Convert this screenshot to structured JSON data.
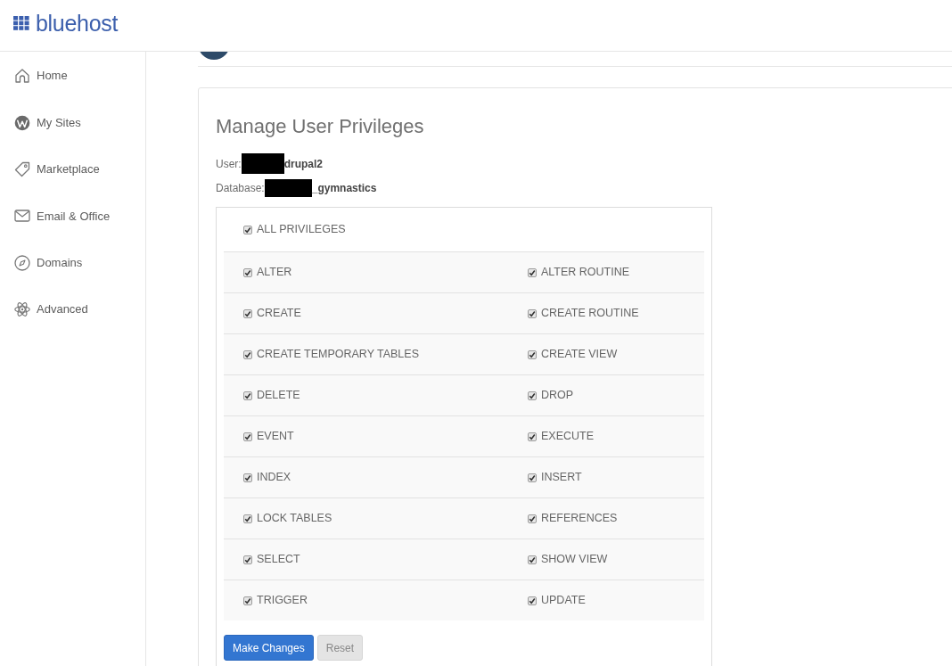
{
  "logo": {
    "text": "bluehost"
  },
  "sidebar": {
    "items": [
      {
        "label": "Home"
      },
      {
        "label": "My Sites"
      },
      {
        "label": "Marketplace"
      },
      {
        "label": "Email & Office"
      },
      {
        "label": "Domains"
      },
      {
        "label": "Advanced"
      }
    ]
  },
  "card": {
    "title": "Manage User Privileges",
    "user": {
      "label": "User:",
      "value": "drupal2"
    },
    "database": {
      "label": "Database:",
      "value": "_gymnastics"
    },
    "all_privileges": {
      "label": "ALL PRIVILEGES",
      "checked": true
    },
    "privileges": [
      {
        "label": "ALTER",
        "checked": true
      },
      {
        "label": "ALTER ROUTINE",
        "checked": true
      },
      {
        "label": "CREATE",
        "checked": true
      },
      {
        "label": "CREATE ROUTINE",
        "checked": true
      },
      {
        "label": "CREATE TEMPORARY TABLES",
        "checked": true
      },
      {
        "label": "CREATE VIEW",
        "checked": true
      },
      {
        "label": "DELETE",
        "checked": true
      },
      {
        "label": "DROP",
        "checked": true
      },
      {
        "label": "EVENT",
        "checked": true
      },
      {
        "label": "EXECUTE",
        "checked": true
      },
      {
        "label": "INDEX",
        "checked": true
      },
      {
        "label": "INSERT",
        "checked": true
      },
      {
        "label": "LOCK TABLES",
        "checked": true
      },
      {
        "label": "REFERENCES",
        "checked": true
      },
      {
        "label": "SELECT",
        "checked": true
      },
      {
        "label": "SHOW VIEW",
        "checked": true
      },
      {
        "label": "TRIGGER",
        "checked": true
      },
      {
        "label": "UPDATE",
        "checked": true
      }
    ],
    "buttons": [
      {
        "label": "Make Changes",
        "kind": "primary"
      },
      {
        "label": "Reset",
        "kind": "secondary"
      }
    ]
  }
}
